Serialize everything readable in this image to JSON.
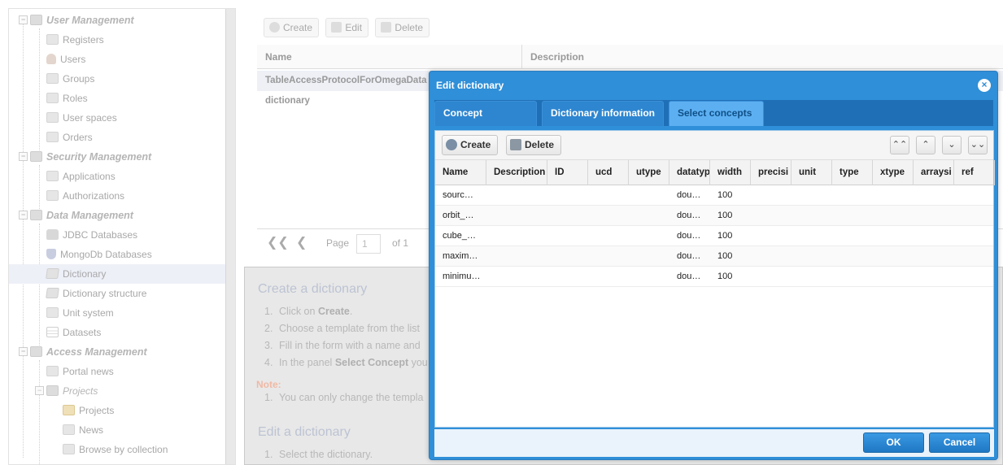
{
  "sidebar": {
    "items": [
      {
        "label": "User Management",
        "kind": "group",
        "icon": "folder-icon"
      },
      {
        "label": "Registers",
        "kind": "item",
        "icon": "register-icon"
      },
      {
        "label": "Users",
        "kind": "item",
        "icon": "user-icon"
      },
      {
        "label": "Groups",
        "kind": "item",
        "icon": "group-icon"
      },
      {
        "label": "Roles",
        "kind": "item",
        "icon": "role-icon"
      },
      {
        "label": "User spaces",
        "kind": "item",
        "icon": "cloud-icon"
      },
      {
        "label": "Orders",
        "kind": "item",
        "icon": "order-icon"
      },
      {
        "label": "Security Management",
        "kind": "group",
        "icon": "folder-icon"
      },
      {
        "label": "Applications",
        "kind": "item",
        "icon": "key-icon"
      },
      {
        "label": "Authorizations",
        "kind": "item",
        "icon": "lock-icon"
      },
      {
        "label": "Data Management",
        "kind": "group",
        "icon": "folder-icon"
      },
      {
        "label": "JDBC Databases",
        "kind": "item",
        "icon": "database-icon"
      },
      {
        "label": "MongoDb Databases",
        "kind": "item",
        "icon": "shield-icon"
      },
      {
        "label": "Dictionary",
        "kind": "item",
        "icon": "book-icon",
        "selected": true
      },
      {
        "label": "Dictionary structure",
        "kind": "item",
        "icon": "book-icon"
      },
      {
        "label": "Unit system",
        "kind": "item",
        "icon": "ruler-icon"
      },
      {
        "label": "Datasets",
        "kind": "item",
        "icon": "table-icon"
      },
      {
        "label": "Access Management",
        "kind": "group",
        "icon": "folder-icon"
      },
      {
        "label": "Portal news",
        "kind": "item",
        "icon": "rss-icon"
      },
      {
        "label": "Projects",
        "kind": "subgroup",
        "icon": "folder-icon"
      },
      {
        "label": "Projects",
        "kind": "subitem",
        "icon": "project-icon"
      },
      {
        "label": "News",
        "kind": "subitem",
        "icon": "rss-icon"
      },
      {
        "label": "Browse by collection",
        "kind": "subitem",
        "icon": "collection-icon"
      }
    ]
  },
  "main": {
    "toolbar": {
      "create": "Create",
      "edit": "Edit",
      "delete": "Delete"
    },
    "columns": {
      "name": "Name",
      "description": "Description"
    },
    "rows": [
      "TableAccessProtocolForOmegaData",
      "dictionary"
    ],
    "pager": {
      "page_label": "Page",
      "page_value": "1",
      "of_label": "of 1"
    },
    "help": {
      "create_title": "Create a dictionary",
      "steps": [
        {
          "n": "1.",
          "pre": "Click on ",
          "bold": "Create",
          "post": "."
        },
        {
          "n": "2.",
          "pre": "Choose a template from the list",
          "bold": "",
          "post": ""
        },
        {
          "n": "3.",
          "pre": "Fill in the form with a name and",
          "bold": "",
          "post": ""
        },
        {
          "n": "4.",
          "pre": "In the panel ",
          "bold": "Select Concept",
          "post": " you"
        }
      ],
      "note_label": "Note:",
      "note_steps": [
        {
          "n": "1.",
          "text": "You can only change the templa"
        }
      ],
      "edit_title": "Edit a dictionary",
      "edit_steps": [
        {
          "n": "1.",
          "text": "Select the dictionary."
        }
      ]
    }
  },
  "dialog": {
    "title": "Edit dictionary",
    "tabs": [
      "Concept templates",
      "Dictionary information",
      "Select concepts"
    ],
    "active_tab": 2,
    "toolbar": {
      "create": "Create",
      "delete": "Delete"
    },
    "columns": [
      "Name",
      "Description",
      "ID",
      "ucd",
      "utype",
      "datatyp",
      "width",
      "precisi",
      "unit",
      "type",
      "xtype",
      "arraysi",
      "ref"
    ],
    "rows": [
      [
        "sourc…",
        "",
        "",
        "",
        "",
        "dou…",
        "100",
        "",
        "",
        "",
        "",
        "",
        ""
      ],
      [
        "orbit_…",
        "",
        "",
        "",
        "",
        "dou…",
        "100",
        "",
        "",
        "",
        "",
        "",
        ""
      ],
      [
        "cube_…",
        "",
        "",
        "",
        "",
        "dou…",
        "100",
        "",
        "",
        "",
        "",
        "",
        ""
      ],
      [
        "maxim…",
        "",
        "",
        "",
        "",
        "dou…",
        "100",
        "",
        "",
        "",
        "",
        "",
        ""
      ],
      [
        "minimu…",
        "",
        "",
        "",
        "",
        "dou…",
        "100",
        "",
        "",
        "",
        "",
        "",
        ""
      ]
    ],
    "buttons": {
      "ok": "OK",
      "cancel": "Cancel"
    }
  },
  "colors": {
    "dialog_blue": "#2f8fd8",
    "tab_active": "#5cb0f2",
    "group_text": "#b5b5b5"
  }
}
